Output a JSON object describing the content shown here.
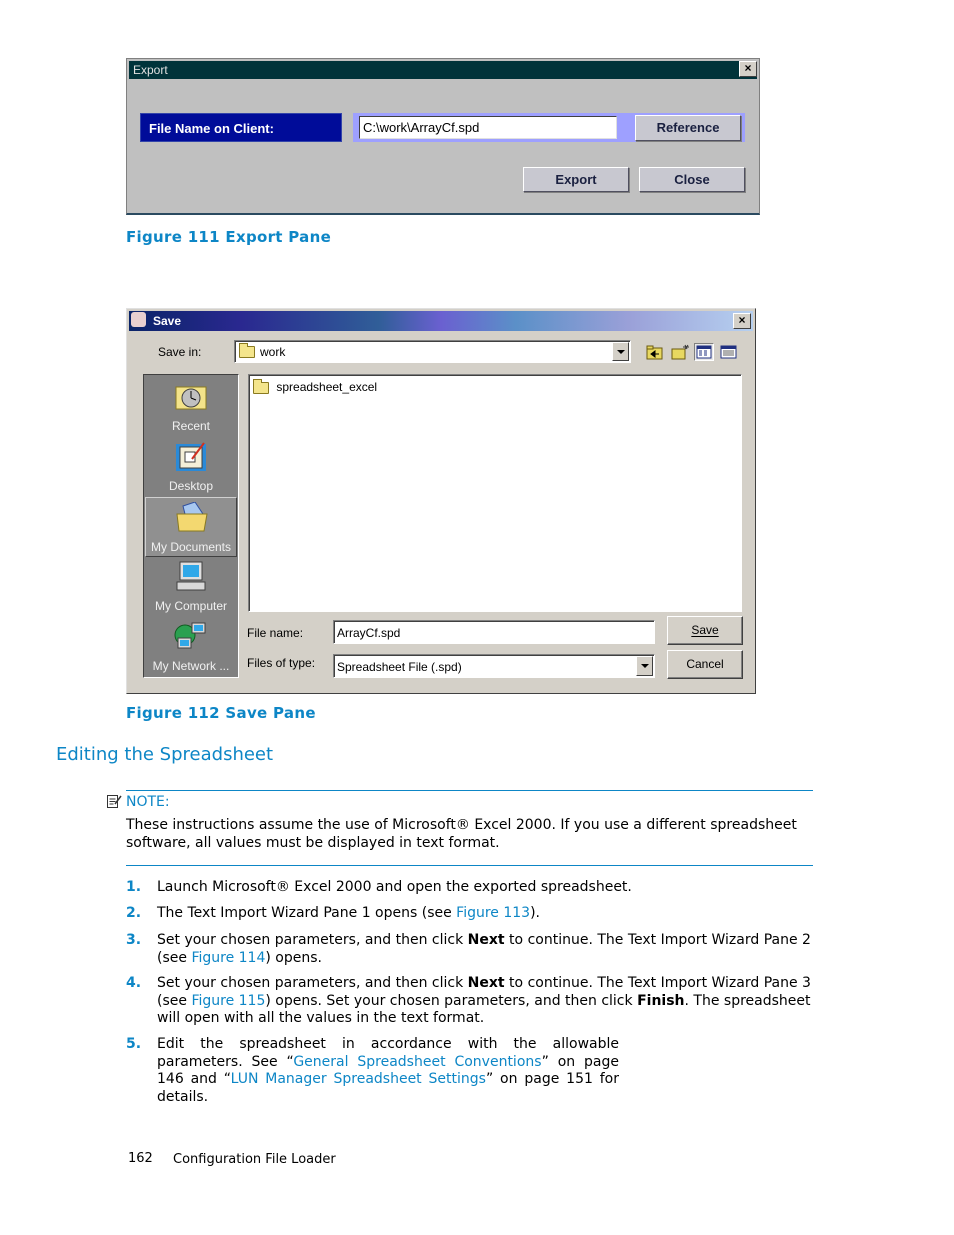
{
  "figure111": {
    "caption": "Figure  111  Export Pane",
    "dialog": {
      "title": "Export",
      "close_label": "×",
      "field_label": "File Name on Client:",
      "field_value": "C:\\work\\ArrayCf.spd",
      "reference_label": "Reference",
      "export_label": "Export",
      "close_button_label": "Close"
    }
  },
  "figure112": {
    "caption": "Figure  112  Save Pane",
    "dialog": {
      "title": "Save",
      "close_label": "×",
      "save_in_label": "Save in:",
      "save_in_value": "work",
      "toolbar": [
        "up-one-level-icon",
        "create-new-folder-icon",
        "list-view-icon",
        "details-view-icon"
      ],
      "places": [
        {
          "label": "Recent",
          "icon": "recent-icon",
          "selected": false
        },
        {
          "label": "Desktop",
          "icon": "desktop-icon",
          "selected": false
        },
        {
          "label": "My Documents",
          "icon": "my-documents-icon",
          "selected": true
        },
        {
          "label": "My Computer",
          "icon": "my-computer-icon",
          "selected": false
        },
        {
          "label": "My Network ...",
          "icon": "my-network-icon",
          "selected": false
        }
      ],
      "files": [
        {
          "name": "spreadsheet_excel",
          "type": "folder"
        }
      ],
      "file_name_label": "File name:",
      "file_name_value": "ArrayCf.spd",
      "file_type_label": "Files of type:",
      "file_type_value": "Spreadsheet File (.spd)",
      "save_label": "Save",
      "cancel_label": "Cancel"
    }
  },
  "section": {
    "title": "Editing the Spreadsheet",
    "note_label": "NOTE:",
    "note_text": "These instructions assume the use of Microsoft® Excel 2000. If you use a different spreadsheet software, all values must be displayed in text format.",
    "steps": [
      {
        "num": "1.",
        "parts": [
          "Launch Microsoft® Excel 2000 and open the exported spreadsheet."
        ]
      },
      {
        "num": "2.",
        "pre": "The Text Import Wizard Pane 1 opens (see ",
        "link": "Figure 113",
        "post": ")."
      },
      {
        "num": "3.",
        "pre": "Set your chosen parameters, and then click ",
        "bold": "Next",
        "mid": " to continue.  The Text Import Wizard Pane 2 (see ",
        "link": "Figure 114",
        "post": ") opens."
      },
      {
        "num": "4.",
        "pre": "Set your chosen parameters, and then click ",
        "bold": "Next",
        "mid": " to continue.  The Text Import Wizard Pane 3 (see ",
        "link": "Figure 115",
        "mid2": ") opens.  Set your chosen parameters, and then click ",
        "bold2": "Finish",
        "post": ".  The spreadsheet will open with all the values in the text format."
      },
      {
        "num": "5.",
        "pre": "Edit the spreadsheet in accordance with the allowable parameters.  See “",
        "link": "General Spreadsheet Conventions",
        "mid": "” on page 146 and “",
        "link2": "LUN Manager Spreadsheet Settings",
        "post": "” on page 151 for details."
      }
    ]
  },
  "footer": {
    "page_number": "162",
    "chapter": "Configuration File Loader"
  },
  "colors": {
    "accent": "#0d86c6",
    "export_label_bg": "#000c99"
  }
}
